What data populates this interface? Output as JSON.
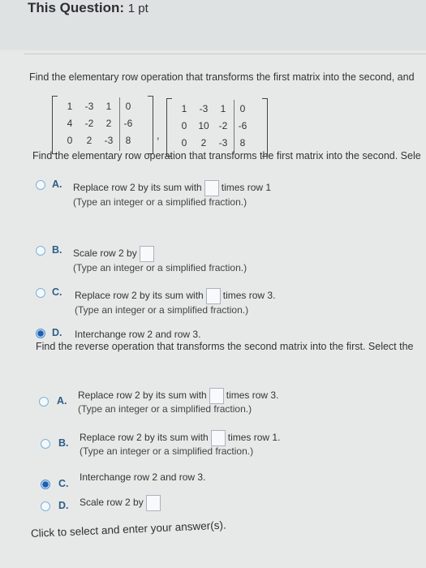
{
  "header": {
    "title": "This Question:",
    "points": "1 pt"
  },
  "question": {
    "prompt": "Find the elementary row operation that transforms the first matrix into the second, and",
    "matrix1": [
      [
        "1",
        "-3",
        "1",
        "0"
      ],
      [
        "4",
        "-2",
        "2",
        "-6"
      ],
      [
        "0",
        "2",
        "-3",
        "8"
      ]
    ],
    "matrix2": [
      [
        "1",
        "-3",
        "1",
        "0"
      ],
      [
        "0",
        "10",
        "-2",
        "-6"
      ],
      [
        "0",
        "2",
        "-3",
        "8"
      ]
    ],
    "separator": ",",
    "part1_prompt": "Find the elementary row operation that transforms the first matrix into the second. Sele",
    "part1_options": [
      {
        "letter": "A.",
        "text_before": "Replace row 2 by its sum with",
        "text_after": "times row 1",
        "hint": "(Type an integer or a simplified fraction.)"
      },
      {
        "letter": "B.",
        "text_before": "Scale row 2 by",
        "text_after": "",
        "hint": "(Type an integer or a simplified fraction.)"
      },
      {
        "letter": "C.",
        "text_before": "Replace row 2 by its sum with",
        "text_after": "times row 3.",
        "hint": "(Type an integer or a simplified fraction.)"
      },
      {
        "letter": "D.",
        "text_before": "Interchange row 2 and row 3.",
        "text_after": "",
        "hint": ""
      }
    ],
    "part2_prompt": "Find the reverse operation that transforms the second matrix into the first. Select the",
    "part2_options": [
      {
        "letter": "A.",
        "text_before": "Replace row 2 by its sum with",
        "text_after": "times row 3.",
        "hint": "(Type an integer or a simplified fraction.)"
      },
      {
        "letter": "B.",
        "text_before": "Replace row 2 by its sum with",
        "text_after": "times row 1.",
        "hint": "(Type an integer or a simplified fraction.)"
      },
      {
        "letter": "C.",
        "text_before": "Interchange row 2 and row 3.",
        "text_after": "",
        "hint": ""
      },
      {
        "letter": "D.",
        "text_before": "Scale row 2 by",
        "text_after": "",
        "hint": ""
      }
    ]
  },
  "footer": "Click to select and enter your answer(s).",
  "colors": {
    "accent": "#1f5fb0",
    "radio_ring": "#7bb3d6",
    "background": "#e7e9e9"
  }
}
